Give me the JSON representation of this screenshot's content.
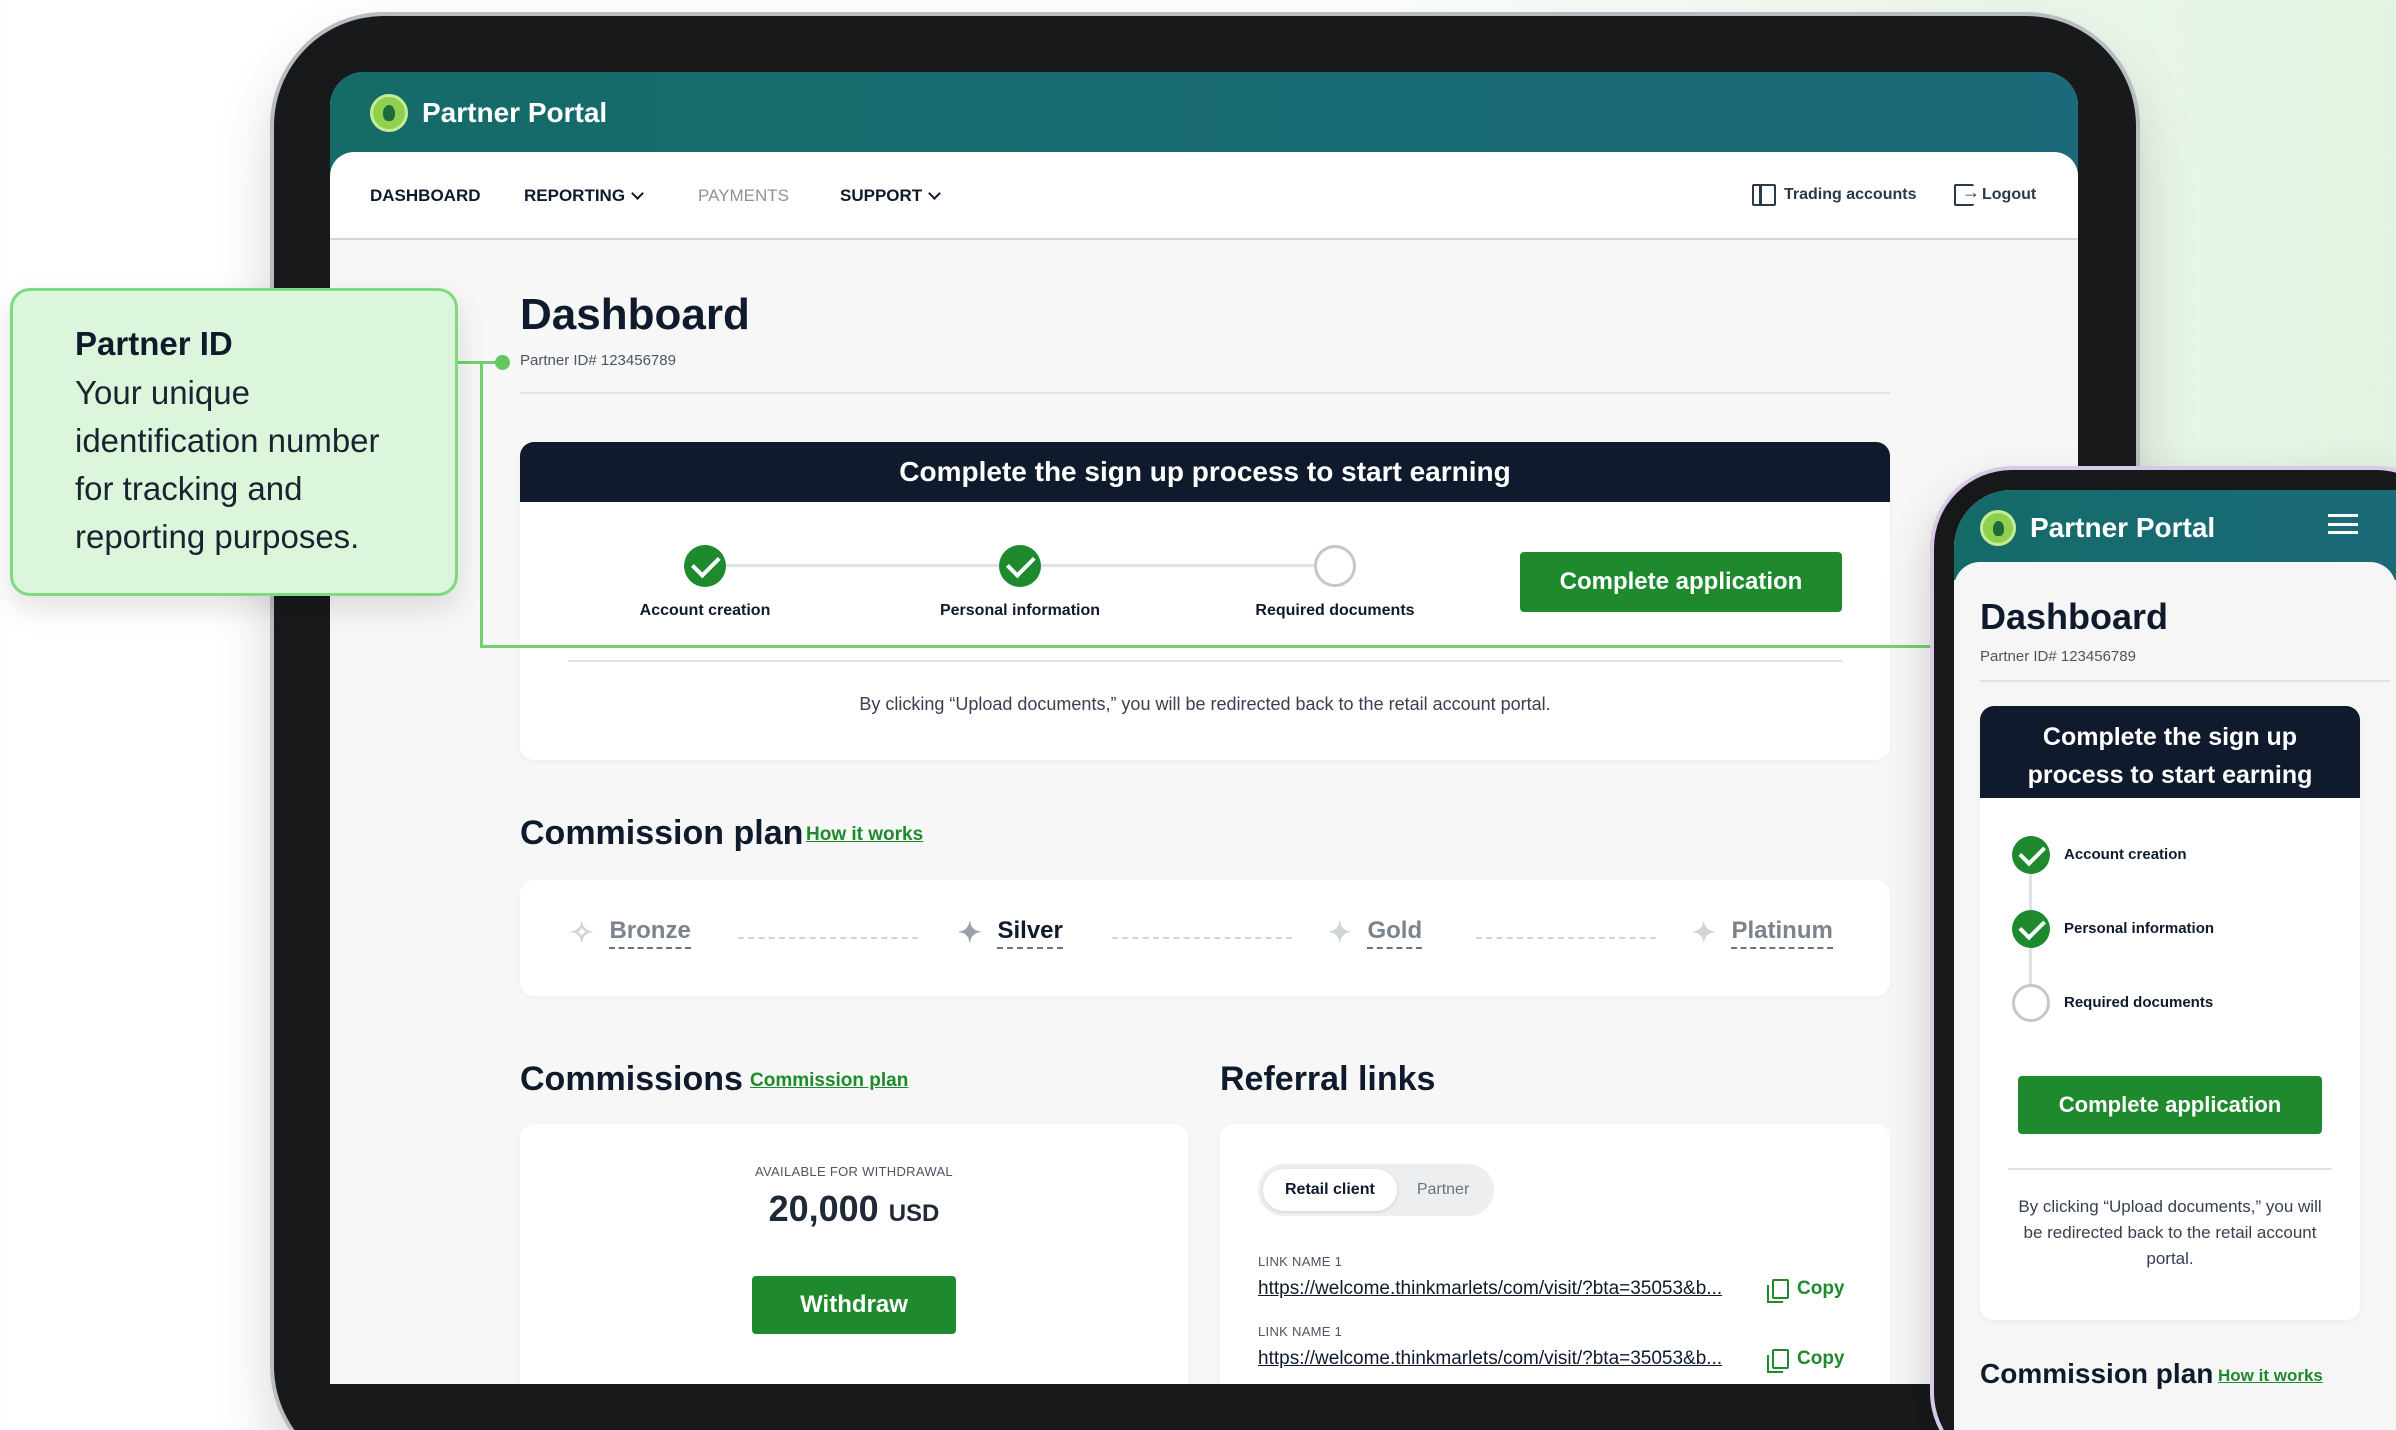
{
  "portal": {
    "brand": "Partner Portal"
  },
  "nav": {
    "dashboard": "DASHBOARD",
    "reporting": "REPORTING",
    "payments": "PAYMENTS",
    "support": "SUPPORT",
    "trading_accounts": "Trading accounts",
    "logout": "Logout"
  },
  "page": {
    "title": "Dashboard",
    "partner_id": "Partner ID# 123456789"
  },
  "signup": {
    "banner": "Complete the sign up process to start earning",
    "steps": [
      {
        "label": "Account creation",
        "done": true
      },
      {
        "label": "Personal information",
        "done": true
      },
      {
        "label": "Required documents",
        "done": false
      }
    ],
    "cta": "Complete application",
    "note": "By clicking “Upload documents,” you will be redirected back to the retail account portal."
  },
  "commission_plan": {
    "title": "Commission plan",
    "link": "How it works",
    "tiers": [
      "Bronze",
      "Silver",
      "Gold",
      "Platinum"
    ],
    "active_tier": "Silver"
  },
  "commissions": {
    "title": "Commissions",
    "link": "Commission plan",
    "available_label": "AVAILABLE FOR WITHDRAWAL",
    "amount": "20,000",
    "currency": "USD",
    "withdraw": "Withdraw"
  },
  "referral": {
    "title": "Referral links",
    "tabs": [
      "Retail client",
      "Partner"
    ],
    "links": [
      {
        "name": "LINK NAME 1",
        "url": "https://welcome.thinkmarlets/com/visit/?bta=35053&b...",
        "copy": "Copy"
      },
      {
        "name": "LINK NAME 1",
        "url": "https://welcome.thinkmarlets/com/visit/?bta=35053&b...",
        "copy": "Copy"
      }
    ]
  },
  "callout": {
    "title": "Partner ID",
    "body": "Your unique identification number for tracking and reporting purposes."
  },
  "mobile": {
    "banner": "Complete the sign up process to start earning",
    "note": "By clicking “Upload documents,” you will be redirected back to the retail account portal."
  },
  "colors": {
    "accent": "#1e8a2d",
    "header": "#146b68",
    "banner": "#0f1b2d",
    "callout_bg": "#dcf6dc"
  }
}
